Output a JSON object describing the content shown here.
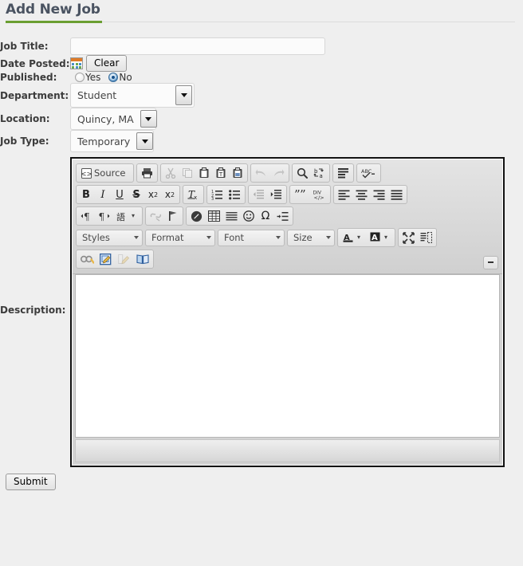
{
  "page": {
    "title": "Add New Job",
    "accent_green": "#6a9e31",
    "title_color": "#4a5361",
    "background": "#efefef"
  },
  "form": {
    "fields": {
      "job_title": {
        "label": "Job Title:",
        "value": "",
        "placeholder": ""
      },
      "date_posted": {
        "label": "Date Posted:",
        "clear_label": "Clear",
        "calendar_icon": "calendar-icon"
      },
      "published": {
        "label": "Published:",
        "options": [
          {
            "label": "Yes",
            "checked": false
          },
          {
            "label": "No",
            "checked": true
          }
        ]
      },
      "department": {
        "label": "Department:",
        "value": "Student"
      },
      "location": {
        "label": "Location:",
        "value": "Quincy, MA"
      },
      "job_type": {
        "label": "Job Type:",
        "value": "Temporary"
      },
      "description": {
        "label": "Description:",
        "value": ""
      }
    },
    "submit_label": "Submit"
  },
  "editor": {
    "toolbar_rows": [
      {
        "groups": [
          {
            "buttons": [
              {
                "name": "source",
                "label": "Source",
                "disabled": false
              }
            ]
          },
          {
            "buttons": [
              {
                "name": "print",
                "label": "",
                "disabled": false
              }
            ]
          },
          {
            "buttons": [
              {
                "name": "cut",
                "label": "",
                "disabled": true
              },
              {
                "name": "copy",
                "label": "",
                "disabled": true
              },
              {
                "name": "paste",
                "label": "",
                "disabled": false
              },
              {
                "name": "paste-text",
                "label": "",
                "disabled": false
              },
              {
                "name": "paste-word",
                "label": "",
                "disabled": false
              }
            ]
          },
          {
            "buttons": [
              {
                "name": "undo",
                "label": "",
                "disabled": true
              },
              {
                "name": "redo",
                "label": "",
                "disabled": true
              }
            ]
          },
          {
            "buttons": [
              {
                "name": "find",
                "label": "",
                "disabled": false
              },
              {
                "name": "replace",
                "label": "",
                "disabled": false
              }
            ]
          },
          {
            "buttons": [
              {
                "name": "select-all",
                "label": "",
                "disabled": false
              }
            ]
          },
          {
            "buttons": [
              {
                "name": "spell-check",
                "label": "",
                "disabled": false
              }
            ]
          }
        ]
      },
      {
        "groups": [
          {
            "buttons": [
              {
                "name": "bold",
                "label": "B",
                "disabled": false
              },
              {
                "name": "italic",
                "label": "I",
                "disabled": false
              },
              {
                "name": "underline",
                "label": "U",
                "disabled": false
              },
              {
                "name": "strikethrough",
                "label": "S",
                "disabled": false
              },
              {
                "name": "subscript",
                "label": "x",
                "disabled": false
              },
              {
                "name": "superscript",
                "label": "x",
                "disabled": false
              }
            ]
          },
          {
            "buttons": [
              {
                "name": "remove-format",
                "label": "",
                "disabled": false
              }
            ]
          },
          {
            "buttons": [
              {
                "name": "numbered-list",
                "label": "",
                "disabled": false
              },
              {
                "name": "bulleted-list",
                "label": "",
                "disabled": false
              }
            ]
          },
          {
            "buttons": [
              {
                "name": "decrease-indent",
                "label": "",
                "disabled": true
              },
              {
                "name": "increase-indent",
                "label": "",
                "disabled": false
              }
            ]
          },
          {
            "buttons": [
              {
                "name": "blockquote",
                "label": "",
                "disabled": false
              },
              {
                "name": "create-div",
                "label": "",
                "disabled": false
              }
            ]
          },
          {
            "buttons": [
              {
                "name": "align-left",
                "label": "",
                "disabled": false
              },
              {
                "name": "align-center",
                "label": "",
                "disabled": false
              },
              {
                "name": "align-right",
                "label": "",
                "disabled": false
              },
              {
                "name": "align-justify",
                "label": "",
                "disabled": false
              }
            ]
          }
        ]
      },
      {
        "groups": [
          {
            "buttons": [
              {
                "name": "text-direction-ltr",
                "label": "",
                "disabled": false
              },
              {
                "name": "text-direction-rtl",
                "label": "",
                "disabled": false
              },
              {
                "name": "language",
                "label": "",
                "disabled": false
              }
            ]
          },
          {
            "buttons": [
              {
                "name": "unlink",
                "label": "",
                "disabled": true
              },
              {
                "name": "anchor",
                "label": "",
                "disabled": false
              }
            ]
          },
          {
            "buttons": [
              {
                "name": "flash",
                "label": "",
                "disabled": false
              },
              {
                "name": "table",
                "label": "",
                "disabled": false
              },
              {
                "name": "horizontal-rule",
                "label": "",
                "disabled": false
              },
              {
                "name": "smiley",
                "label": "",
                "disabled": false
              },
              {
                "name": "special-character",
                "label": "Ω",
                "disabled": false
              },
              {
                "name": "page-break",
                "label": "",
                "disabled": false
              }
            ]
          }
        ]
      },
      {
        "combos": [
          {
            "name": "styles",
            "label": "Styles"
          },
          {
            "name": "format",
            "label": "Format"
          },
          {
            "name": "font",
            "label": "Font"
          },
          {
            "name": "size",
            "label": "Size"
          }
        ],
        "groups": [
          {
            "buttons": [
              {
                "name": "text-color",
                "label": "A",
                "disabled": false
              },
              {
                "name": "background-color",
                "label": "A",
                "disabled": false
              }
            ]
          },
          {
            "buttons": [
              {
                "name": "maximize",
                "label": "",
                "disabled": false
              },
              {
                "name": "show-blocks",
                "label": "",
                "disabled": false
              }
            ]
          }
        ]
      },
      {
        "groups": [
          {
            "buttons": [
              {
                "name": "accessibility-check",
                "label": "",
                "disabled": false
              },
              {
                "name": "insert-template",
                "label": "",
                "disabled": false
              },
              {
                "name": "edit-source",
                "label": "",
                "disabled": true
              },
              {
                "name": "documentation",
                "label": "",
                "disabled": false
              }
            ]
          }
        ]
      }
    ],
    "collapse_toolbar_title": "",
    "content": "",
    "status": ""
  }
}
